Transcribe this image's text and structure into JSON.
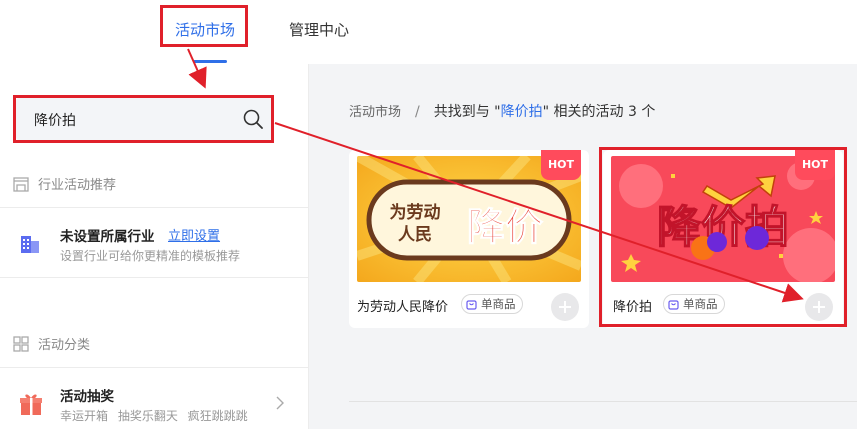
{
  "nav": {
    "tabs": [
      {
        "label": "活动市场",
        "active": true
      },
      {
        "label": "管理中心",
        "active": false
      }
    ]
  },
  "sidebar": {
    "search": {
      "value": "降价拍",
      "icon": "search-icon"
    },
    "industry_section": {
      "title": "行业活动推荐",
      "icon": "shop-icon"
    },
    "industry": {
      "title": "未设置所属行业",
      "link": "立即设置",
      "desc": "设置行业可给你更精准的模板推荐",
      "icon": "building-icon"
    },
    "category_section": {
      "title": "活动分类",
      "icon": "grid-icon"
    },
    "lottery": {
      "title": "活动抽奖",
      "desc": "幸运开箱 抽奖乐翻天 疯狂跳跳跳",
      "icon": "gift-icon"
    }
  },
  "main": {
    "breadcrumb": {
      "root": "活动市场",
      "sep": "/",
      "prefix": "共找到与 \"",
      "keyword": "降价拍",
      "suffix": "\" 相关的活动 3 个"
    },
    "cards": [
      {
        "name": "为劳动人民降价",
        "tag": "单商品",
        "badge": "HOT",
        "banner_line1": "为劳动",
        "banner_line2": "人民",
        "banner_big": "降价"
      },
      {
        "name": "降价拍",
        "tag": "单商品",
        "badge": "HOT",
        "banner_big": "降价拍"
      }
    ]
  },
  "colors": {
    "accent": "#2f6fe8",
    "highlight": "#e0202a"
  }
}
